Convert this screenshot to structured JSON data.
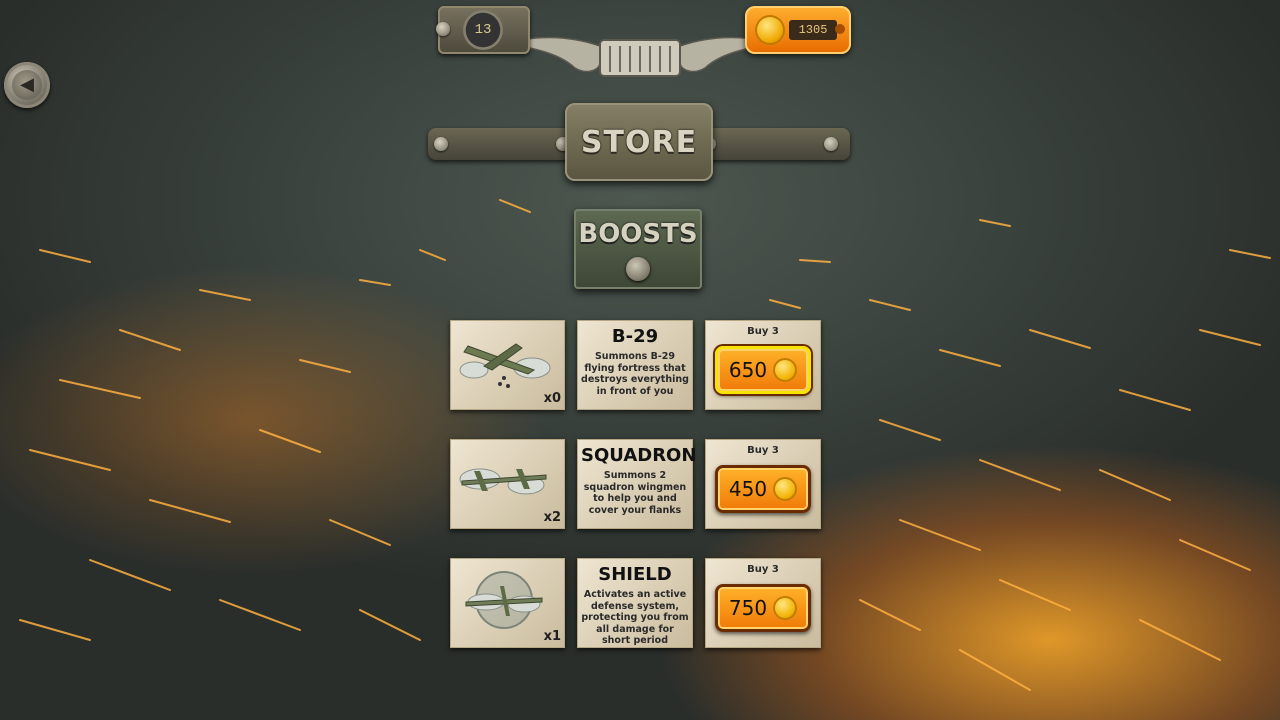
{
  "header": {
    "level": "13",
    "coins": "1305"
  },
  "store": {
    "title": "STORE",
    "tab_label": "BOOSTS"
  },
  "items": [
    {
      "name": "B-29",
      "quantity": "x0",
      "description": "Summons B-29 flying fortress that destroys everything in front of you",
      "buy_label": "Buy 3",
      "price": "650",
      "icon": "b29-bomber-icon"
    },
    {
      "name": "SQUADRON",
      "quantity": "x2",
      "description": "Summons 2 squadron wingmen to help you and cover your flanks",
      "buy_label": "Buy 3",
      "price": "450",
      "icon": "squadron-icon"
    },
    {
      "name": "SHIELD",
      "quantity": "x1",
      "description": "Activates an active defense system, protecting you from all damage for short period",
      "buy_label": "Buy 3",
      "price": "750",
      "icon": "shield-icon"
    }
  ],
  "colors": {
    "accent_orange": "#f07a08",
    "coin_gold": "#f2b100",
    "card_paper": "#e4d9c1"
  }
}
